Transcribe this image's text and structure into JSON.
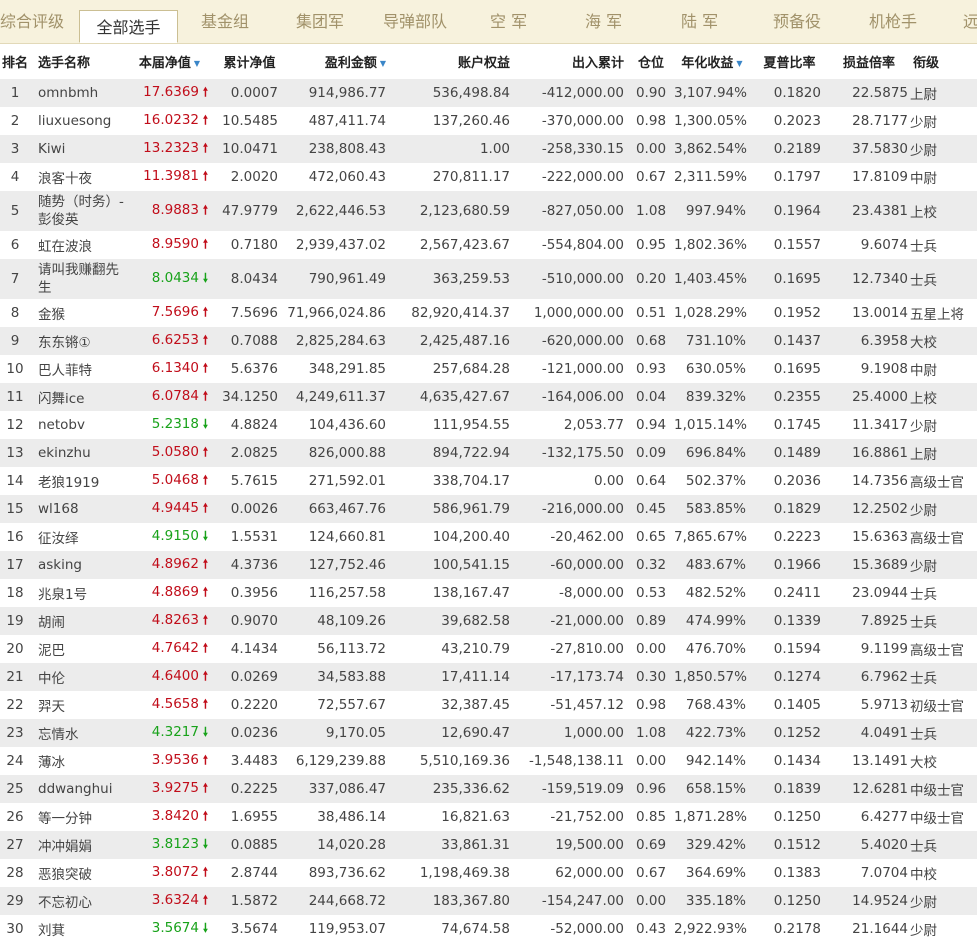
{
  "tabs": [
    "综合评级",
    "全部选手",
    "基金组",
    "集团军",
    "导弹部队",
    "空 军",
    "海 军",
    "陆 军",
    "预备役",
    "机枪手",
    "远"
  ],
  "active_tab": 1,
  "columns": [
    "排名",
    "选手名称",
    "本届净值",
    "累计净值",
    "盈利金额",
    "账户权益",
    "出入累计",
    "仓位",
    "年化收益",
    "夏普比率",
    "损益倍率",
    "衔级"
  ],
  "sortable_columns": [
    2,
    4,
    8
  ],
  "trend_colors": {
    "up": "#c10d1a",
    "down": "#18a21a"
  },
  "trend_icons": {
    "up": "red-up-arrow-icon",
    "down": "green-down-arrow-icon"
  },
  "rows": [
    {
      "rank": "1",
      "name": "omnbmh",
      "nav": "17.6369",
      "trend": "up",
      "cum": "0.0007",
      "profit": "914,986.77",
      "equity": "536,498.84",
      "flow": "-412,000.00",
      "pos": "0.90",
      "annual": "3,107.94%",
      "sharpe": "0.1820",
      "ratio": "22.5875",
      "grade": "上尉"
    },
    {
      "rank": "2",
      "name": "liuxuesong",
      "nav": "16.0232",
      "trend": "up",
      "cum": "10.5485",
      "profit": "487,411.74",
      "equity": "137,260.46",
      "flow": "-370,000.00",
      "pos": "0.98",
      "annual": "1,300.05%",
      "sharpe": "0.2023",
      "ratio": "28.7177",
      "grade": "少尉"
    },
    {
      "rank": "3",
      "name": "Kiwi",
      "nav": "13.2323",
      "trend": "up",
      "cum": "10.0471",
      "profit": "238,808.43",
      "equity": "1.00",
      "flow": "-258,330.15",
      "pos": "0.00",
      "annual": "3,862.54%",
      "sharpe": "0.2189",
      "ratio": "37.5830",
      "grade": "少尉"
    },
    {
      "rank": "4",
      "name": "浪客十夜",
      "nav": "11.3981",
      "trend": "up",
      "cum": "2.0020",
      "profit": "472,060.43",
      "equity": "270,811.17",
      "flow": "-222,000.00",
      "pos": "0.67",
      "annual": "2,311.59%",
      "sharpe": "0.1797",
      "ratio": "17.8109",
      "grade": "中尉"
    },
    {
      "rank": "5",
      "name": "随势（时务）-彭俊英",
      "nav": "8.9883",
      "trend": "up",
      "cum": "47.9779",
      "profit": "2,622,446.53",
      "equity": "2,123,680.59",
      "flow": "-827,050.00",
      "pos": "1.08",
      "annual": "997.94%",
      "sharpe": "0.1964",
      "ratio": "23.4381",
      "grade": "上校"
    },
    {
      "rank": "6",
      "name": "虹在波浪",
      "nav": "8.9590",
      "trend": "up",
      "cum": "0.7180",
      "profit": "2,939,437.02",
      "equity": "2,567,423.67",
      "flow": "-554,804.00",
      "pos": "0.95",
      "annual": "1,802.36%",
      "sharpe": "0.1557",
      "ratio": "9.6074",
      "grade": "士兵"
    },
    {
      "rank": "7",
      "name": "请叫我赚翻先生",
      "nav": "8.0434",
      "trend": "down",
      "cum": "8.0434",
      "profit": "790,961.49",
      "equity": "363,259.53",
      "flow": "-510,000.00",
      "pos": "0.20",
      "annual": "1,403.45%",
      "sharpe": "0.1695",
      "ratio": "12.7340",
      "grade": "士兵"
    },
    {
      "rank": "8",
      "name": "金猴",
      "nav": "7.5696",
      "trend": "up",
      "cum": "7.5696",
      "profit": "71,966,024.86",
      "equity": "82,920,414.37",
      "flow": "1,000,000.00",
      "pos": "0.51",
      "annual": "1,028.29%",
      "sharpe": "0.1952",
      "ratio": "13.0014",
      "grade": "五星上将"
    },
    {
      "rank": "9",
      "name": "东东锵①",
      "nav": "6.6253",
      "trend": "up",
      "cum": "0.7088",
      "profit": "2,825,284.63",
      "equity": "2,425,487.16",
      "flow": "-620,000.00",
      "pos": "0.68",
      "annual": "731.10%",
      "sharpe": "0.1437",
      "ratio": "6.3958",
      "grade": "大校"
    },
    {
      "rank": "10",
      "name": "巴人菲特",
      "nav": "6.1340",
      "trend": "up",
      "cum": "5.6376",
      "profit": "348,291.85",
      "equity": "257,684.28",
      "flow": "-121,000.00",
      "pos": "0.93",
      "annual": "630.05%",
      "sharpe": "0.1695",
      "ratio": "9.1908",
      "grade": "中尉"
    },
    {
      "rank": "11",
      "name": "闪舞ice",
      "nav": "6.0784",
      "trend": "up",
      "cum": "34.1250",
      "profit": "4,249,611.37",
      "equity": "4,635,427.67",
      "flow": "-164,006.00",
      "pos": "0.04",
      "annual": "839.32%",
      "sharpe": "0.2355",
      "ratio": "25.4000",
      "grade": "上校"
    },
    {
      "rank": "12",
      "name": "netobv",
      "nav": "5.2318",
      "trend": "down",
      "cum": "4.8824",
      "profit": "104,436.60",
      "equity": "111,954.55",
      "flow": "2,053.77",
      "pos": "0.94",
      "annual": "1,015.14%",
      "sharpe": "0.1745",
      "ratio": "11.3417",
      "grade": "少尉"
    },
    {
      "rank": "13",
      "name": "ekinzhu",
      "nav": "5.0580",
      "trend": "up",
      "cum": "2.0825",
      "profit": "826,000.88",
      "equity": "894,722.94",
      "flow": "-132,175.50",
      "pos": "0.09",
      "annual": "696.84%",
      "sharpe": "0.1489",
      "ratio": "16.8861",
      "grade": "上尉"
    },
    {
      "rank": "14",
      "name": "老狼1919",
      "nav": "5.0468",
      "trend": "up",
      "cum": "5.7615",
      "profit": "271,592.01",
      "equity": "338,704.17",
      "flow": "0.00",
      "pos": "0.64",
      "annual": "502.37%",
      "sharpe": "0.2036",
      "ratio": "14.7356",
      "grade": "高级士官"
    },
    {
      "rank": "15",
      "name": "wl168",
      "nav": "4.9445",
      "trend": "up",
      "cum": "0.0026",
      "profit": "663,467.76",
      "equity": "586,961.79",
      "flow": "-216,000.00",
      "pos": "0.45",
      "annual": "583.85%",
      "sharpe": "0.1829",
      "ratio": "12.2502",
      "grade": "少尉"
    },
    {
      "rank": "16",
      "name": "征汝绎",
      "nav": "4.9150",
      "trend": "down",
      "cum": "1.5531",
      "profit": "124,660.81",
      "equity": "104,200.40",
      "flow": "-20,462.00",
      "pos": "0.65",
      "annual": "7,865.67%",
      "sharpe": "0.2223",
      "ratio": "15.6363",
      "grade": "高级士官"
    },
    {
      "rank": "17",
      "name": "asking",
      "nav": "4.8962",
      "trend": "up",
      "cum": "4.3736",
      "profit": "127,752.46",
      "equity": "100,541.15",
      "flow": "-60,000.00",
      "pos": "0.32",
      "annual": "483.67%",
      "sharpe": "0.1966",
      "ratio": "15.3689",
      "grade": "少尉"
    },
    {
      "rank": "18",
      "name": "兆泉1号",
      "nav": "4.8869",
      "trend": "up",
      "cum": "0.3956",
      "profit": "116,257.58",
      "equity": "138,167.47",
      "flow": "-8,000.00",
      "pos": "0.53",
      "annual": "482.52%",
      "sharpe": "0.2411",
      "ratio": "23.0944",
      "grade": "士兵"
    },
    {
      "rank": "19",
      "name": "胡闹",
      "nav": "4.8263",
      "trend": "up",
      "cum": "0.9070",
      "profit": "48,109.26",
      "equity": "39,682.58",
      "flow": "-21,000.00",
      "pos": "0.89",
      "annual": "474.99%",
      "sharpe": "0.1339",
      "ratio": "7.8925",
      "grade": "士兵"
    },
    {
      "rank": "20",
      "name": "泥巴",
      "nav": "4.7642",
      "trend": "up",
      "cum": "4.1434",
      "profit": "56,113.72",
      "equity": "43,210.79",
      "flow": "-27,810.00",
      "pos": "0.00",
      "annual": "476.70%",
      "sharpe": "0.1594",
      "ratio": "9.1199",
      "grade": "高级士官"
    },
    {
      "rank": "21",
      "name": "中伦",
      "nav": "4.6400",
      "trend": "up",
      "cum": "0.0269",
      "profit": "34,583.88",
      "equity": "17,411.14",
      "flow": "-17,173.74",
      "pos": "0.30",
      "annual": "1,850.57%",
      "sharpe": "0.1274",
      "ratio": "6.7962",
      "grade": "士兵"
    },
    {
      "rank": "22",
      "name": "羿天",
      "nav": "4.5658",
      "trend": "up",
      "cum": "0.2220",
      "profit": "72,557.67",
      "equity": "32,387.45",
      "flow": "-51,457.12",
      "pos": "0.98",
      "annual": "768.43%",
      "sharpe": "0.1405",
      "ratio": "5.9713",
      "grade": "初级士官"
    },
    {
      "rank": "23",
      "name": "忘情水",
      "nav": "4.3217",
      "trend": "down",
      "cum": "0.0236",
      "profit": "9,170.05",
      "equity": "12,690.47",
      "flow": "1,000.00",
      "pos": "1.08",
      "annual": "422.73%",
      "sharpe": "0.1252",
      "ratio": "4.0491",
      "grade": "士兵"
    },
    {
      "rank": "24",
      "name": "薄冰",
      "nav": "3.9536",
      "trend": "up",
      "cum": "3.4483",
      "profit": "6,129,239.88",
      "equity": "5,510,169.36",
      "flow": "-1,548,138.11",
      "pos": "0.00",
      "annual": "942.14%",
      "sharpe": "0.1434",
      "ratio": "13.1491",
      "grade": "大校"
    },
    {
      "rank": "25",
      "name": "ddwanghui",
      "nav": "3.9275",
      "trend": "up",
      "cum": "0.2225",
      "profit": "337,086.47",
      "equity": "235,336.62",
      "flow": "-159,519.09",
      "pos": "0.96",
      "annual": "658.15%",
      "sharpe": "0.1839",
      "ratio": "12.6281",
      "grade": "中级士官"
    },
    {
      "rank": "26",
      "name": "等一分钟",
      "nav": "3.8420",
      "trend": "up",
      "cum": "1.6955",
      "profit": "38,486.14",
      "equity": "16,821.63",
      "flow": "-21,752.00",
      "pos": "0.85",
      "annual": "1,871.28%",
      "sharpe": "0.1250",
      "ratio": "6.4277",
      "grade": "中级士官"
    },
    {
      "rank": "27",
      "name": "冲冲娟娟",
      "nav": "3.8123",
      "trend": "down",
      "cum": "0.0885",
      "profit": "14,020.28",
      "equity": "33,861.31",
      "flow": "19,500.00",
      "pos": "0.69",
      "annual": "329.42%",
      "sharpe": "0.1512",
      "ratio": "5.4020",
      "grade": "士兵"
    },
    {
      "rank": "28",
      "name": "恶狼突破",
      "nav": "3.8072",
      "trend": "up",
      "cum": "2.8744",
      "profit": "893,736.62",
      "equity": "1,198,469.38",
      "flow": "62,000.00",
      "pos": "0.67",
      "annual": "364.69%",
      "sharpe": "0.1383",
      "ratio": "7.0704",
      "grade": "中校"
    },
    {
      "rank": "29",
      "name": "不忘初心",
      "nav": "3.6324",
      "trend": "up",
      "cum": "1.5872",
      "profit": "244,668.72",
      "equity": "183,367.80",
      "flow": "-154,247.00",
      "pos": "0.00",
      "annual": "335.18%",
      "sharpe": "0.1250",
      "ratio": "14.9524",
      "grade": "少尉"
    },
    {
      "rank": "30",
      "name": "刘萁",
      "nav": "3.5674",
      "trend": "down",
      "cum": "3.5674",
      "profit": "119,953.07",
      "equity": "74,674.58",
      "flow": "-52,000.00",
      "pos": "0.43",
      "annual": "2,922.93%",
      "sharpe": "0.2178",
      "ratio": "21.1644",
      "grade": "少尉"
    }
  ]
}
